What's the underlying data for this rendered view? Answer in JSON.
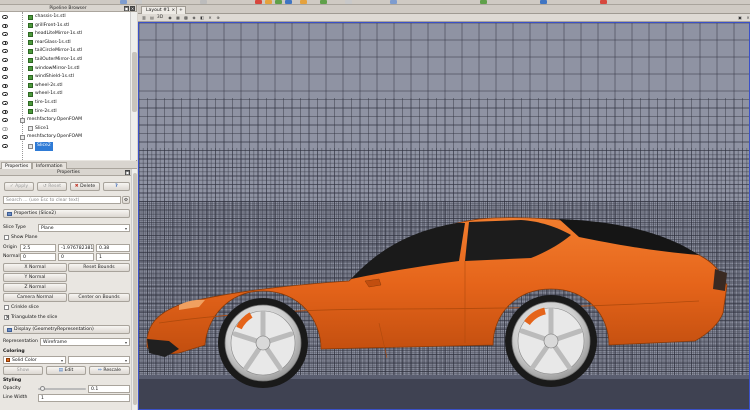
{
  "pipeline_browser": {
    "title": "Pipeline Browser",
    "items": [
      {
        "label": "chassis-1s.stl",
        "visible": true,
        "indent": 1
      },
      {
        "label": "grillFront-1s.stl",
        "visible": true,
        "indent": 1
      },
      {
        "label": "headLiteMirror-1s.stl",
        "visible": true,
        "indent": 1
      },
      {
        "label": "rearGlass-1s.stl",
        "visible": true,
        "indent": 1
      },
      {
        "label": "tailCircleMirror-1s.stl",
        "visible": true,
        "indent": 1
      },
      {
        "label": "tailOuterMirror-1s.stl",
        "visible": true,
        "indent": 1
      },
      {
        "label": "windowMirror-1s.stl",
        "visible": true,
        "indent": 1
      },
      {
        "label": "windShield-1s.stl",
        "visible": true,
        "indent": 1
      },
      {
        "label": "wheel-2s.stl",
        "visible": true,
        "indent": 1
      },
      {
        "label": "wheel-1s.stl",
        "visible": true,
        "indent": 1
      },
      {
        "label": "tire-1s.stl",
        "visible": true,
        "indent": 1
      },
      {
        "label": "tire-2s.stl",
        "visible": true,
        "indent": 1
      },
      {
        "label": "meshfactory.OpenFOAM",
        "visible": true,
        "indent": 0,
        "gray": true
      },
      {
        "label": "Slice1",
        "visible": false,
        "indent": 1,
        "gray": true
      },
      {
        "label": "meshfactory.OpenFOAM",
        "visible": true,
        "indent": 0,
        "gray": true
      },
      {
        "label": "Slice2",
        "visible": true,
        "indent": 1,
        "gray": true,
        "selected": true
      }
    ]
  },
  "tabs": {
    "properties": "Properties",
    "information": "Information"
  },
  "properties": {
    "title": "Properties",
    "apply": "Apply",
    "reset": "Reset",
    "delete": "Delete",
    "help": "?",
    "search_placeholder": "Search ... (use Esc to clear text)",
    "section_properties": "Properties (Slice2)",
    "slice_type_label": "Slice Type",
    "slice_type_value": "Plane",
    "show_plane": "Show Plane",
    "origin_label": "Origin",
    "origin": [
      "2.5",
      "-1.97678238151",
      "0.38"
    ],
    "normal_label": "Normal",
    "normal": [
      "0",
      "0",
      "1"
    ],
    "x_normal": "X Normal",
    "reset_bounds": "Reset Bounds",
    "y_normal": "Y Normal",
    "z_normal": "Z Normal",
    "camera_normal": "Camera Normal",
    "center_on_bounds": "Center on Bounds",
    "crinkle_slice": "Crinkle slice",
    "triangulate_slice": "Triangulate the slice",
    "section_display": "Display (GeometryRepresentation)",
    "representation_label": "Representation",
    "representation_value": "Wireframe",
    "coloring_label": "Coloring",
    "coloring_value": "Solid Color",
    "show_btn": "Show",
    "edit_btn": "Edit",
    "rescale_btn": "Rescale",
    "styling_label": "Styling",
    "opacity_label": "Opacity",
    "opacity_value": "0.1",
    "opacity_level": 0.1,
    "line_width_label": "Line Width",
    "line_width_value": "1"
  },
  "layout": {
    "tab_label": "Layout #1",
    "add_tab": "+"
  },
  "viewport_toolbar": {
    "mode_3d": "3D"
  },
  "colors": {
    "car_body": "#e5641a",
    "mesh_bg": "#8f93a3",
    "selection": "#2f7bd6"
  }
}
